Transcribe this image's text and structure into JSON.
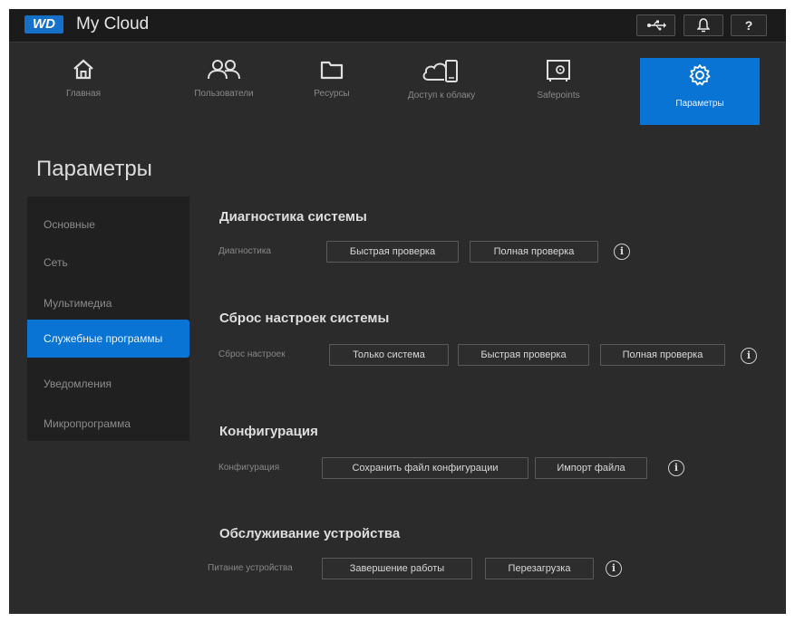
{
  "header": {
    "logo": "WD",
    "app_title": "My Cloud",
    "icons": {
      "usb": "usb-icon",
      "bell": "bell-icon",
      "help": "?"
    }
  },
  "nav": {
    "items": [
      {
        "label": "Главная",
        "icon": "home-icon"
      },
      {
        "label": "Пользователи",
        "icon": "users-icon"
      },
      {
        "label": "Ресурсы",
        "icon": "folder-icon"
      },
      {
        "label": "Доступ к облаку",
        "icon": "cloud-access-icon"
      },
      {
        "label": "Safepoints",
        "icon": "safe-icon"
      },
      {
        "label": "Параметры",
        "icon": "gear-icon",
        "active": true
      }
    ]
  },
  "page_title": "Параметры",
  "sidebar": {
    "items": [
      {
        "label": "Основные"
      },
      {
        "label": "Сеть"
      },
      {
        "label": "Мультимедиа"
      },
      {
        "label": "Служебные программы",
        "active": true
      },
      {
        "label": "Уведомления"
      },
      {
        "label": "Микропрограмма"
      }
    ]
  },
  "sections": {
    "diagnostics": {
      "title": "Диагностика системы",
      "row_label": "Диагностика",
      "buttons": [
        "Быстрая проверка",
        "Полная проверка"
      ]
    },
    "reset": {
      "title": "Сброс настроек системы",
      "row_label": "Сброс настроек",
      "buttons": [
        "Только система",
        "Быстрая проверка",
        "Полная проверка"
      ]
    },
    "config": {
      "title": "Конфигурация",
      "row_label": "Конфигурация",
      "buttons": [
        "Сохранить файл конфигурации",
        "Импорт файла"
      ]
    },
    "maintenance": {
      "title": "Обслуживание устройства",
      "row_label": "Питание устройства",
      "buttons": [
        "Завершение работы",
        "Перезагрузка"
      ]
    }
  },
  "info_glyph": "i",
  "colors": {
    "accent": "#0a74d4",
    "background": "#2b2b2b",
    "topbar": "#1b1b1b",
    "logo": "#1570c9"
  }
}
